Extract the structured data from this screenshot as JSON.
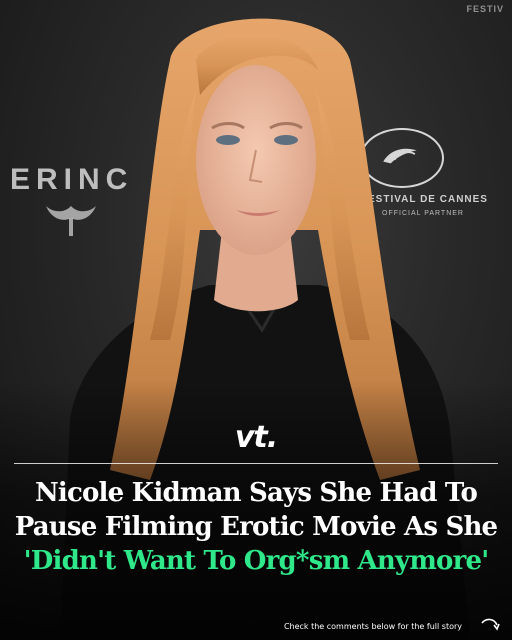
{
  "backdrop": {
    "left_wordmark": "ERINC",
    "festival_top": "FESTIV",
    "cannes_line_1": "ESTIVAL DE CANNES",
    "cannes_line_2": "OFFICIAL PARTNER"
  },
  "post": {
    "brand": "vt.",
    "headline_lines": [
      "Nicole Kidman Says She Had To",
      "Pause Filming Erotic Movie As She"
    ],
    "headline_accent": "'Didn't Want To Org*sm Anymore'",
    "footer_note": "Check the comments below for the full story"
  },
  "colors": {
    "accent": "#2ee88a",
    "text": "#ffffff",
    "background": "#1b1b1b"
  },
  "icons": {
    "arrow": "curved-arrow-icon"
  }
}
